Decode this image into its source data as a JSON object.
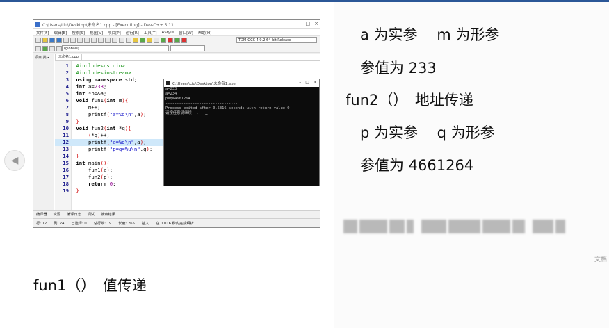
{
  "slide": {
    "lines": [
      "a 为实参 　m 为形参",
      "参值为  233",
      "fun2（）　地址传递",
      "p 为实参 　q 为形参",
      "参值为  4661264"
    ],
    "fun1_caption": "fun1（）　值传递",
    "doc_tag": "文档"
  },
  "ide": {
    "window_title": "C:\\Users\\Liu\\Desktop\\未命名1.cpp - [Executing] - Dev-C++ 5.11",
    "menu": [
      "文件[F]",
      "编辑[E]",
      "搜索[S]",
      "视图[V]",
      "项目[P]",
      "运行[R]",
      "工具[T]",
      "AStyle",
      "窗口[W]",
      "帮助[H]"
    ],
    "compiler": "TDM-GCC 4.9.2 64-bit Release",
    "scope": "(globals)",
    "panel_tabs": "项目 类 ◂",
    "file_tab": "未命名1.cpp",
    "code": [
      {
        "n": "1",
        "t": "#include<cstdio>"
      },
      {
        "n": "2",
        "t": "#include<iostream>"
      },
      {
        "n": "3",
        "t": "using namespace std;"
      },
      {
        "n": "4",
        "t": "int a=233;"
      },
      {
        "n": "5",
        "t": "int *p=&a;"
      },
      {
        "n": "6",
        "t": "void fun1(int m){"
      },
      {
        "n": "7",
        "t": "    m++;"
      },
      {
        "n": "8",
        "t": "    printf(\"a=%d\\n\",a);"
      },
      {
        "n": "9",
        "t": "}"
      },
      {
        "n": "10",
        "t": "void fun2(int *q){"
      },
      {
        "n": "11",
        "t": "    (*q)++;"
      },
      {
        "n": "12",
        "t": "    printf(\"a=%d\\n\",a);"
      },
      {
        "n": "13",
        "t": "    printf(\"p=q=%u\\n\",q);"
      },
      {
        "n": "14",
        "t": "}"
      },
      {
        "n": "15",
        "t": "int main(){"
      },
      {
        "n": "16",
        "t": "    fun1(a);"
      },
      {
        "n": "17",
        "t": "    fun2(p);"
      },
      {
        "n": "18",
        "t": "    return 0;"
      },
      {
        "n": "19",
        "t": "}"
      }
    ],
    "console": {
      "title": "C:\\Users\\Liu\\Desktop\\未命名1.exe",
      "lines": [
        "a=233",
        "a=234",
        "p=q=4661264",
        "",
        "--------------------------------",
        "Process exited after 0.5316 seconds with return value 0",
        "请按任意键继续. . . ▁"
      ]
    },
    "bottom_tabs": [
      "编译器",
      "资源",
      "编译日志",
      "调试",
      "搜索结果"
    ],
    "status": {
      "row_label": "行: 12",
      "col_label": "列: 24",
      "sel_label": "已选择: 0",
      "total_label": "总行数: 19",
      "len_label": "长度: 265",
      "mode": "插入",
      "parse": "在 0.016 秒内完成解析"
    }
  }
}
